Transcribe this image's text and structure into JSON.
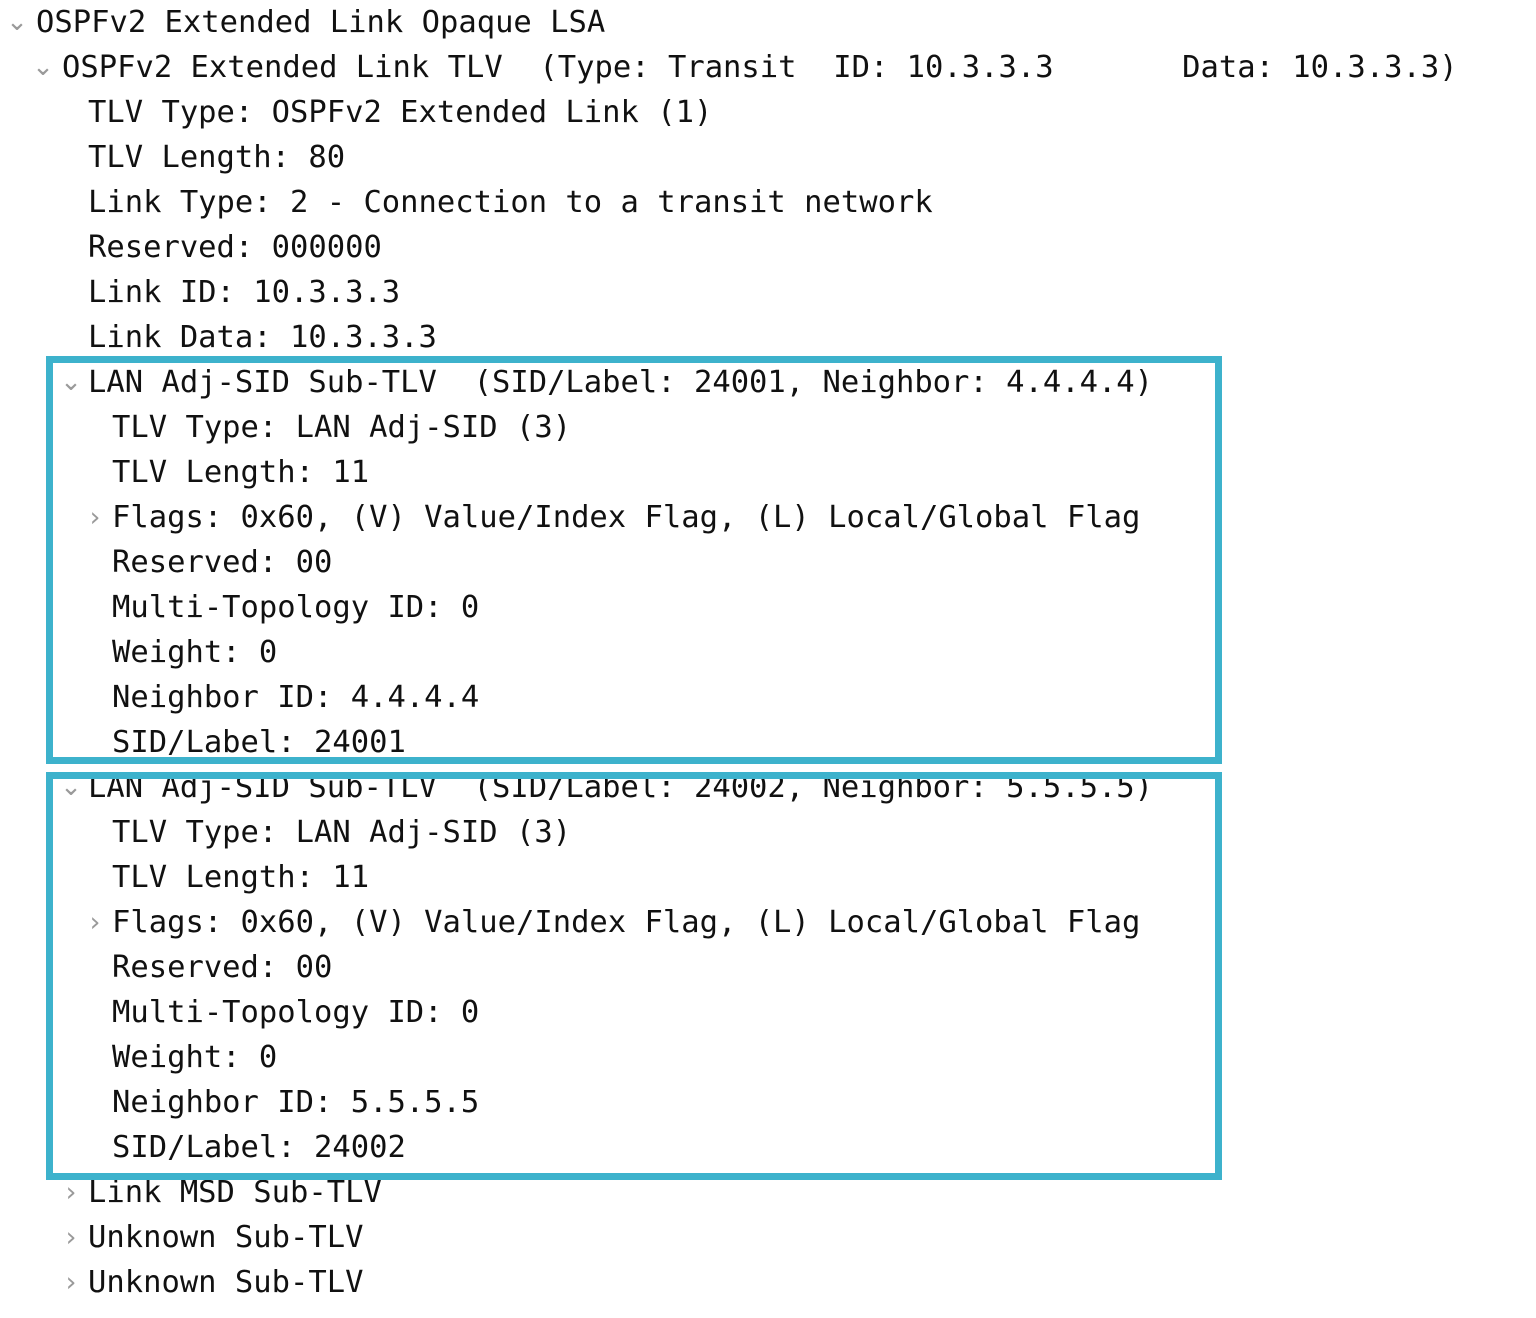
{
  "view": {
    "kind": "packet-detail-tree",
    "highlight_color": "#3db2cc",
    "text_color": "#111111",
    "background": "#ffffff"
  },
  "icons": {
    "expanded": "chevron-down-icon",
    "collapsed": "chevron-right-icon"
  },
  "rows": [
    {
      "id": "r0",
      "level": 0,
      "chevron": "down",
      "text": "OSPFv2 Extended Link Opaque LSA"
    },
    {
      "id": "r1",
      "level": 1,
      "chevron": "down",
      "text": "OSPFv2 Extended Link TLV  (Type: Transit  ID: 10.3.3.3       Data: 10.3.3.3)"
    },
    {
      "id": "r2",
      "level": 2,
      "chevron": "none",
      "text": "TLV Type: OSPFv2 Extended Link (1)"
    },
    {
      "id": "r3",
      "level": 2,
      "chevron": "none",
      "text": "TLV Length: 80"
    },
    {
      "id": "r4",
      "level": 2,
      "chevron": "none",
      "text": "Link Type: 2 - Connection to a transit network"
    },
    {
      "id": "r5",
      "level": 2,
      "chevron": "none",
      "text": "Reserved: 000000"
    },
    {
      "id": "r6",
      "level": 2,
      "chevron": "none",
      "text": "Link ID: 10.3.3.3"
    },
    {
      "id": "r7",
      "level": 2,
      "chevron": "none",
      "text": "Link Data: 10.3.3.3"
    },
    {
      "id": "r8",
      "level": 2,
      "chevron": "down",
      "text": "LAN Adj-SID Sub-TLV  (SID/Label: 24001, Neighbor: 4.4.4.4)"
    },
    {
      "id": "r9",
      "level": 3,
      "chevron": "none",
      "text": "TLV Type: LAN Adj-SID (3)"
    },
    {
      "id": "r10",
      "level": 3,
      "chevron": "none",
      "text": "TLV Length: 11"
    },
    {
      "id": "r11",
      "level": 3,
      "chevron": "right",
      "text": "Flags: 0x60, (V) Value/Index Flag, (L) Local/Global Flag"
    },
    {
      "id": "r12",
      "level": 3,
      "chevron": "none",
      "text": "Reserved: 00"
    },
    {
      "id": "r13",
      "level": 3,
      "chevron": "none",
      "text": "Multi-Topology ID: 0"
    },
    {
      "id": "r14",
      "level": 3,
      "chevron": "none",
      "text": "Weight: 0"
    },
    {
      "id": "r15",
      "level": 3,
      "chevron": "none",
      "text": "Neighbor ID: 4.4.4.4"
    },
    {
      "id": "r16",
      "level": 3,
      "chevron": "none",
      "text": "SID/Label: 24001"
    },
    {
      "id": "r17",
      "level": 2,
      "chevron": "down",
      "text": "LAN Adj-SID Sub-TLV  (SID/Label: 24002, Neighbor: 5.5.5.5)"
    },
    {
      "id": "r18",
      "level": 3,
      "chevron": "none",
      "text": "TLV Type: LAN Adj-SID (3)"
    },
    {
      "id": "r19",
      "level": 3,
      "chevron": "none",
      "text": "TLV Length: 11"
    },
    {
      "id": "r20",
      "level": 3,
      "chevron": "right",
      "text": "Flags: 0x60, (V) Value/Index Flag, (L) Local/Global Flag"
    },
    {
      "id": "r21",
      "level": 3,
      "chevron": "none",
      "text": "Reserved: 00"
    },
    {
      "id": "r22",
      "level": 3,
      "chevron": "none",
      "text": "Multi-Topology ID: 0"
    },
    {
      "id": "r23",
      "level": 3,
      "chevron": "none",
      "text": "Weight: 0"
    },
    {
      "id": "r24",
      "level": 3,
      "chevron": "none",
      "text": "Neighbor ID: 5.5.5.5"
    },
    {
      "id": "r25",
      "level": 3,
      "chevron": "none",
      "text": "SID/Label: 24002"
    },
    {
      "id": "r26",
      "level": 2,
      "chevron": "right",
      "text": "Link MSD Sub-TLV"
    },
    {
      "id": "r27",
      "level": 2,
      "chevron": "right",
      "text": "Unknown Sub-TLV"
    },
    {
      "id": "r28",
      "level": 2,
      "chevron": "right",
      "text": "Unknown Sub-TLV"
    }
  ],
  "highlights": [
    {
      "id": "hl1",
      "label": "lan-adj-sid-subtlv-24001-highlight"
    },
    {
      "id": "hl2",
      "label": "lan-adj-sid-subtlv-24002-highlight"
    }
  ]
}
